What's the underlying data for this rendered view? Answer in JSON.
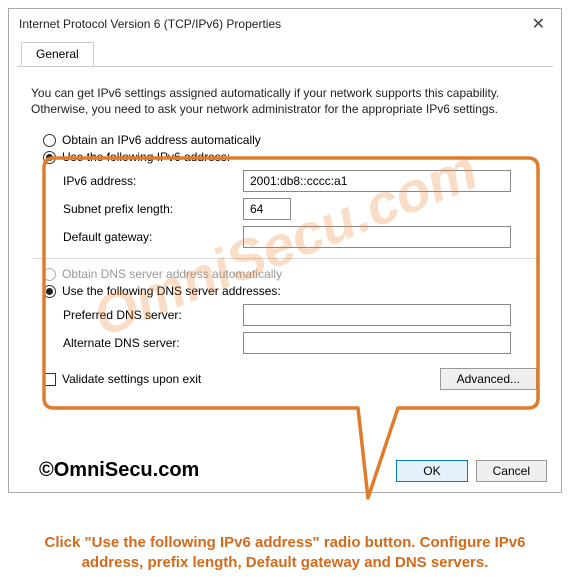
{
  "window": {
    "title": "Internet Protocol Version 6 (TCP/IPv6) Properties"
  },
  "tabs": {
    "general": "General"
  },
  "intro": "You can get IPv6 settings assigned automatically if your network supports this capability. Otherwise, you need to ask your network administrator for the appropriate IPv6 settings.",
  "radios": {
    "auto_addr": "Obtain an IPv6 address automatically",
    "manual_addr": "Use the following IPv6 address:",
    "auto_dns": "Obtain DNS server address automatically",
    "manual_dns": "Use the following DNS server addresses:"
  },
  "fields": {
    "ipv6_label": "IPv6 address:",
    "ipv6_value": "2001:db8::cccc:a1",
    "prefix_label": "Subnet prefix length:",
    "prefix_value": "64",
    "gateway_label": "Default gateway:",
    "gateway_value": "",
    "pref_dns_label": "Preferred DNS server:",
    "pref_dns_value": "",
    "alt_dns_label": "Alternate DNS server:",
    "alt_dns_value": ""
  },
  "validate": "Validate settings upon exit",
  "buttons": {
    "advanced": "Advanced...",
    "ok": "OK",
    "cancel": "Cancel"
  },
  "copyright": "©OmniSecu.com",
  "watermark": "OmniSecu.com",
  "caption": "Click \"Use the following IPv6 address\" radio button. Configure IPv6 address, prefix length, Default gateway and DNS servers."
}
